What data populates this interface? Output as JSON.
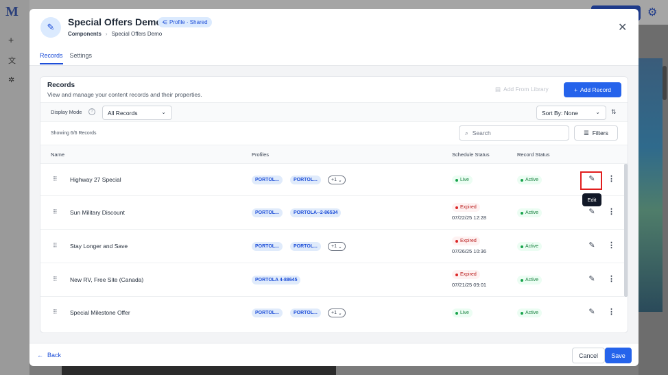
{
  "background": {
    "logo": "M"
  },
  "header": {
    "title": "Special Offers Demo",
    "badge": "Profile · Shared",
    "breadcrumb": [
      "Components",
      "Special Offers Demo"
    ]
  },
  "tabs": [
    {
      "label": "Records",
      "active": true
    },
    {
      "label": "Settings",
      "active": false
    }
  ],
  "records_card": {
    "title": "Records",
    "subtitle": "View and manage your content records and their properties.",
    "add_from_library": "Add From Library",
    "add_record": "Add Record",
    "display_mode_label": "Display Mode",
    "display_mode_value": "All Records",
    "sort_label": "Sort By: None",
    "showing": "Showing 6/6 Records",
    "search_placeholder": "Search",
    "filters": "Filters"
  },
  "table": {
    "columns": [
      "Name",
      "Profiles",
      "Schedule Status",
      "Record Status"
    ],
    "rows": [
      {
        "name": "Highway 27 Special",
        "profiles": [
          "PORTOL...",
          "PORTOL..."
        ],
        "more": "+1",
        "schedule": "Live",
        "date": "",
        "status": "Active"
      },
      {
        "name": "Sun Military Discount",
        "profiles": [
          "PORTOL...",
          "PORTOLA--2-86534"
        ],
        "more": "",
        "schedule": "Expired",
        "date": "07/22/25 12:28",
        "status": "Active"
      },
      {
        "name": "Stay Longer and Save",
        "profiles": [
          "PORTOL...",
          "PORTOL..."
        ],
        "more": "+1",
        "schedule": "Expired",
        "date": "07/26/25 10:36",
        "status": "Active"
      },
      {
        "name": "New RV, Free Site (Canada)",
        "profiles": [
          "PORTOLA 4-88645"
        ],
        "more": "",
        "schedule": "Expired",
        "date": "07/21/25 09:01",
        "status": "Active"
      },
      {
        "name": "Special Milestone Offer",
        "profiles": [
          "PORTOL...",
          "PORTOL..."
        ],
        "more": "+1",
        "schedule": "Live",
        "date": "",
        "status": "Active"
      }
    ]
  },
  "tooltip": "Edit",
  "footer": {
    "back": "Back",
    "cancel": "Cancel",
    "save": "Save"
  },
  "colors": {
    "accent": "#2563eb",
    "highlight": "#e11d1d"
  }
}
